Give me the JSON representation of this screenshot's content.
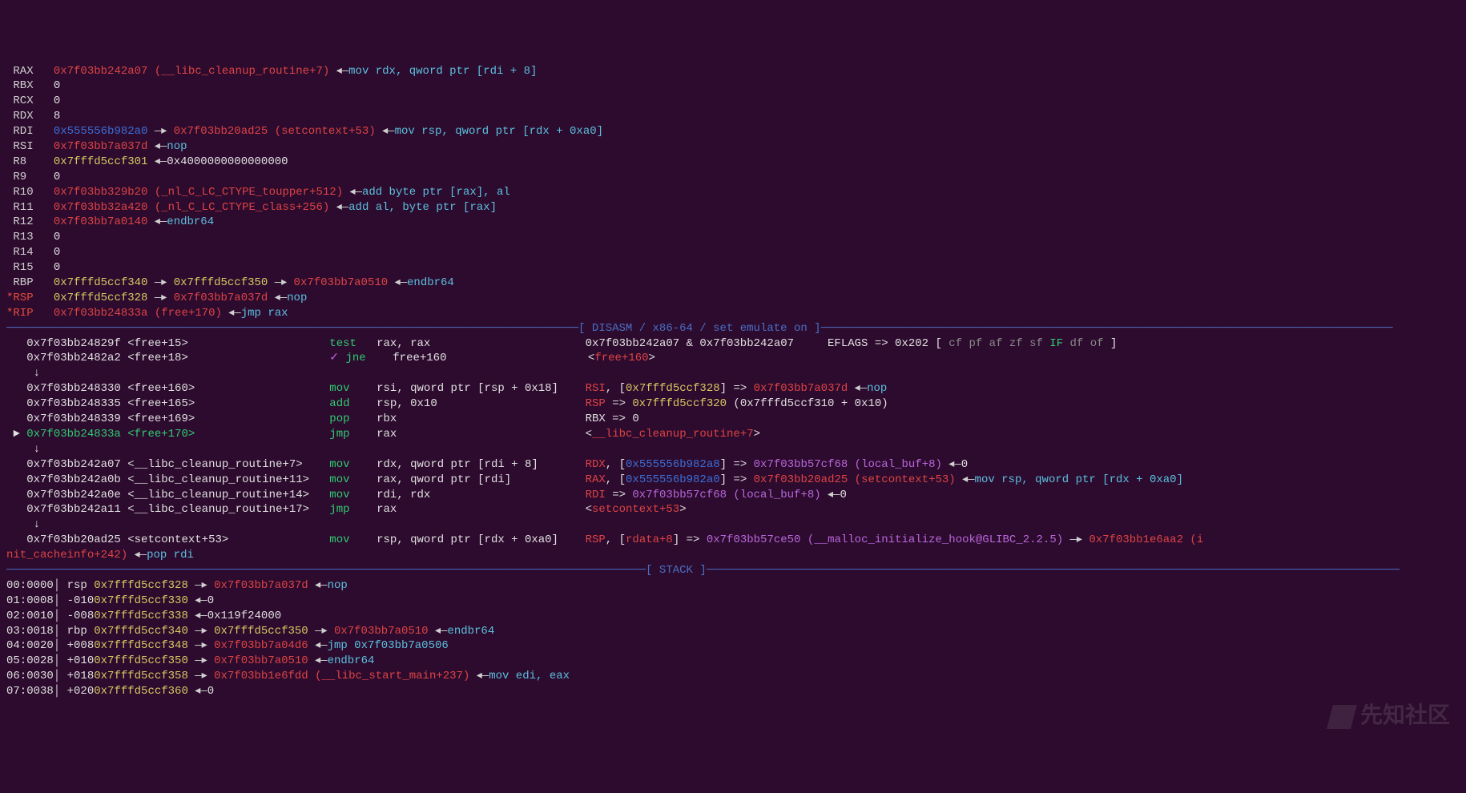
{
  "registers": [
    {
      "name": " RAX",
      "star": false,
      "parts": [
        {
          "cls": "addr-red",
          "t": "0x7f03bb242a07"
        },
        {
          "cls": "sym-red",
          "t": " (__libc_cleanup_routine+7)"
        },
        {
          "cls": "arrow",
          "t": " ◂—"
        },
        {
          "cls": "asm",
          "t": "mov rdx, qword ptr [rdi + 8]"
        }
      ]
    },
    {
      "name": " RBX",
      "star": false,
      "parts": [
        {
          "cls": "white",
          "t": "0"
        }
      ]
    },
    {
      "name": " RCX",
      "star": false,
      "parts": [
        {
          "cls": "white",
          "t": "0"
        }
      ]
    },
    {
      "name": " RDX",
      "star": false,
      "parts": [
        {
          "cls": "white",
          "t": "8"
        }
      ]
    },
    {
      "name": " RDI",
      "star": false,
      "parts": [
        {
          "cls": "addr-blue",
          "t": "0x555556b982a0"
        },
        {
          "cls": "arrow",
          "t": " —▸ "
        },
        {
          "cls": "addr-red",
          "t": "0x7f03bb20ad25"
        },
        {
          "cls": "sym-red",
          "t": " (setcontext+53)"
        },
        {
          "cls": "arrow",
          "t": " ◂—"
        },
        {
          "cls": "asm",
          "t": "mov rsp, qword ptr [rdx + 0xa0]"
        }
      ]
    },
    {
      "name": " RSI",
      "star": false,
      "parts": [
        {
          "cls": "addr-red",
          "t": "0x7f03bb7a037d"
        },
        {
          "cls": "arrow",
          "t": " ◂—"
        },
        {
          "cls": "asm",
          "t": "nop"
        }
      ]
    },
    {
      "name": " R8 ",
      "star": false,
      "parts": [
        {
          "cls": "offset",
          "t": "0x7fffd5ccf301"
        },
        {
          "cls": "arrow",
          "t": " ◂—"
        },
        {
          "cls": "white",
          "t": "0x4000000000000000"
        }
      ]
    },
    {
      "name": " R9 ",
      "star": false,
      "parts": [
        {
          "cls": "white",
          "t": "0"
        }
      ]
    },
    {
      "name": " R10",
      "star": false,
      "parts": [
        {
          "cls": "addr-red",
          "t": "0x7f03bb329b20"
        },
        {
          "cls": "sym-red",
          "t": " (_nl_C_LC_CTYPE_toupper+512)"
        },
        {
          "cls": "arrow",
          "t": " ◂—"
        },
        {
          "cls": "asm",
          "t": "add byte ptr [rax], al"
        }
      ]
    },
    {
      "name": " R11",
      "star": false,
      "parts": [
        {
          "cls": "addr-red",
          "t": "0x7f03bb32a420"
        },
        {
          "cls": "sym-red",
          "t": " (_nl_C_LC_CTYPE_class+256)"
        },
        {
          "cls": "arrow",
          "t": " ◂—"
        },
        {
          "cls": "asm",
          "t": "add al, byte ptr [rax]"
        }
      ]
    },
    {
      "name": " R12",
      "star": false,
      "parts": [
        {
          "cls": "addr-red",
          "t": "0x7f03bb7a0140"
        },
        {
          "cls": "arrow",
          "t": " ◂—"
        },
        {
          "cls": "asm",
          "t": "endbr64"
        }
      ]
    },
    {
      "name": " R13",
      "star": false,
      "parts": [
        {
          "cls": "white",
          "t": "0"
        }
      ]
    },
    {
      "name": " R14",
      "star": false,
      "parts": [
        {
          "cls": "white",
          "t": "0"
        }
      ]
    },
    {
      "name": " R15",
      "star": false,
      "parts": [
        {
          "cls": "white",
          "t": "0"
        }
      ]
    },
    {
      "name": " RBP",
      "star": false,
      "parts": [
        {
          "cls": "offset",
          "t": "0x7fffd5ccf340"
        },
        {
          "cls": "arrow",
          "t": " —▸ "
        },
        {
          "cls": "offset",
          "t": "0x7fffd5ccf350"
        },
        {
          "cls": "arrow",
          "t": " —▸ "
        },
        {
          "cls": "addr-red",
          "t": "0x7f03bb7a0510"
        },
        {
          "cls": "arrow",
          "t": " ◂—"
        },
        {
          "cls": "asm",
          "t": "endbr64"
        }
      ]
    },
    {
      "name": "*RSP",
      "star": true,
      "parts": [
        {
          "cls": "offset",
          "t": "0x7fffd5ccf328"
        },
        {
          "cls": "arrow",
          "t": " —▸ "
        },
        {
          "cls": "addr-red",
          "t": "0x7f03bb7a037d"
        },
        {
          "cls": "arrow",
          "t": " ◂—"
        },
        {
          "cls": "asm",
          "t": "nop"
        }
      ]
    },
    {
      "name": "*RIP",
      "star": true,
      "parts": [
        {
          "cls": "addr-red",
          "t": "0x7f03bb24833a"
        },
        {
          "cls": "sym-red",
          "t": " (free+170)"
        },
        {
          "cls": "arrow",
          "t": " ◂—"
        },
        {
          "cls": "asm",
          "t": "jmp rax"
        }
      ]
    }
  ],
  "disasm_header": "─────────────────────────────────────────────────────────────────────────────────────[ DISASM / x86-64 / set emulate on ]─────────────────────────────────────────────────────────────────────────────────────",
  "disasm": [
    {
      "pre": "   ",
      "addr": "0x7f03bb24829f",
      "acls": "white",
      "sym": "<free+15>",
      "scls": "white",
      "asm": "test   rax, rax",
      "ann": [
        {
          "cls": "white",
          "t": "0x7f03bb242a07 & 0x7f03bb242a07     EFLAGS => 0x202 [ "
        },
        {
          "cls": "flag-off",
          "t": "cf pf af zf sf "
        },
        {
          "cls": "flag-on",
          "t": "IF "
        },
        {
          "cls": "flag-off",
          "t": "df of "
        },
        {
          "cls": "white",
          "t": "]"
        }
      ]
    },
    {
      "pre": "   ",
      "addr": "0x7f03bb2482a2",
      "acls": "white",
      "sym": "<free+18>",
      "scls": "white",
      "asm": "✓ jne    free+160",
      "ann": [
        {
          "cls": "white",
          "t": "<"
        },
        {
          "cls": "sym-red",
          "t": "free+160"
        },
        {
          "cls": "white",
          "t": ">"
        }
      ]
    },
    {
      "pre": "    ↓",
      "addr": "",
      "acls": "",
      "sym": "",
      "scls": "",
      "asm": "",
      "ann": []
    },
    {
      "pre": "   ",
      "addr": "0x7f03bb248330",
      "acls": "white",
      "sym": "<free+160>",
      "scls": "white",
      "asm": "mov    rsi, qword ptr [rsp + 0x18]",
      "ann": [
        {
          "cls": "sym-red",
          "t": "RSI"
        },
        {
          "cls": "white",
          "t": ", ["
        },
        {
          "cls": "offset",
          "t": "0x7fffd5ccf328"
        },
        {
          "cls": "white",
          "t": "] => "
        },
        {
          "cls": "addr-red",
          "t": "0x7f03bb7a037d"
        },
        {
          "cls": "arrow",
          "t": " ◂—"
        },
        {
          "cls": "asm",
          "t": "nop"
        }
      ]
    },
    {
      "pre": "   ",
      "addr": "0x7f03bb248335",
      "acls": "white",
      "sym": "<free+165>",
      "scls": "white",
      "asm": "add    rsp, 0x10",
      "ann": [
        {
          "cls": "sym-red",
          "t": "RSP"
        },
        {
          "cls": "white",
          "t": " => "
        },
        {
          "cls": "offset",
          "t": "0x7fffd5ccf320"
        },
        {
          "cls": "white",
          "t": " (0x7fffd5ccf310 + 0x10)"
        }
      ]
    },
    {
      "pre": "   ",
      "addr": "0x7f03bb248339",
      "acls": "white",
      "sym": "<free+169>",
      "scls": "white",
      "asm": "pop    rbx",
      "ann": [
        {
          "cls": "white",
          "t": "RBX => 0"
        }
      ]
    },
    {
      "pre": " ► ",
      "addr": "0x7f03bb24833a",
      "acls": "addr-green",
      "sym": "<free+170>",
      "scls": "addr-green",
      "asm": "jmp    rax",
      "ann": [
        {
          "cls": "white",
          "t": "<"
        },
        {
          "cls": "sym-red",
          "t": "__libc_cleanup_routine+7"
        },
        {
          "cls": "white",
          "t": ">"
        }
      ]
    },
    {
      "pre": "    ↓",
      "addr": "",
      "acls": "",
      "sym": "",
      "scls": "",
      "asm": "",
      "ann": []
    },
    {
      "pre": "   ",
      "addr": "0x7f03bb242a07",
      "acls": "white",
      "sym": "<__libc_cleanup_routine+7>",
      "scls": "white",
      "asm": "mov    rdx, qword ptr [rdi + 8]",
      "ann": [
        {
          "cls": "sym-red",
          "t": "RDX"
        },
        {
          "cls": "white",
          "t": ", ["
        },
        {
          "cls": "addr-blue",
          "t": "0x555556b982a8"
        },
        {
          "cls": "white",
          "t": "] => "
        },
        {
          "cls": "addr-purple",
          "t": "0x7f03bb57cf68"
        },
        {
          "cls": "sym-purple",
          "t": " (local_buf+8)"
        },
        {
          "cls": "arrow",
          "t": " ◂—"
        },
        {
          "cls": "white",
          "t": "0"
        }
      ]
    },
    {
      "pre": "   ",
      "addr": "0x7f03bb242a0b",
      "acls": "white",
      "sym": "<__libc_cleanup_routine+11>",
      "scls": "white",
      "asm": "mov    rax, qword ptr [rdi]",
      "ann": [
        {
          "cls": "sym-red",
          "t": "RAX"
        },
        {
          "cls": "white",
          "t": ", ["
        },
        {
          "cls": "addr-blue",
          "t": "0x555556b982a0"
        },
        {
          "cls": "white",
          "t": "] => "
        },
        {
          "cls": "addr-red",
          "t": "0x7f03bb20ad25"
        },
        {
          "cls": "sym-red",
          "t": " (setcontext+53)"
        },
        {
          "cls": "arrow",
          "t": " ◂—"
        },
        {
          "cls": "asm",
          "t": "mov rsp, qword ptr [rdx + 0xa0]"
        }
      ]
    },
    {
      "pre": "   ",
      "addr": "0x7f03bb242a0e",
      "acls": "white",
      "sym": "<__libc_cleanup_routine+14>",
      "scls": "white",
      "asm": "mov    rdi, rdx",
      "ann": [
        {
          "cls": "sym-red",
          "t": "RDI"
        },
        {
          "cls": "white",
          "t": " => "
        },
        {
          "cls": "addr-purple",
          "t": "0x7f03bb57cf68"
        },
        {
          "cls": "sym-purple",
          "t": " (local_buf+8)"
        },
        {
          "cls": "arrow",
          "t": " ◂—"
        },
        {
          "cls": "white",
          "t": "0"
        }
      ]
    },
    {
      "pre": "   ",
      "addr": "0x7f03bb242a11",
      "acls": "white",
      "sym": "<__libc_cleanup_routine+17>",
      "scls": "white",
      "asm": "jmp    rax",
      "ann": [
        {
          "cls": "white",
          "t": "<"
        },
        {
          "cls": "sym-red",
          "t": "setcontext+53"
        },
        {
          "cls": "white",
          "t": ">"
        }
      ]
    },
    {
      "pre": "    ↓",
      "addr": "",
      "acls": "",
      "sym": "",
      "scls": "",
      "asm": "",
      "ann": []
    },
    {
      "pre": "   ",
      "addr": "0x7f03bb20ad25",
      "acls": "white",
      "sym": "<setcontext+53>",
      "scls": "white",
      "asm": "mov    rsp, qword ptr [rdx + 0xa0]",
      "ann": [
        {
          "cls": "sym-red",
          "t": "RSP"
        },
        {
          "cls": "white",
          "t": ", ["
        },
        {
          "cls": "sym-red",
          "t": "rdata+8"
        },
        {
          "cls": "white",
          "t": "] => "
        },
        {
          "cls": "addr-purple",
          "t": "0x7f03bb57ce50"
        },
        {
          "cls": "sym-purple",
          "t": " (__malloc_initialize_hook@GLIBC_2.2.5)"
        },
        {
          "cls": "arrow",
          "t": " —▸ "
        },
        {
          "cls": "addr-red",
          "t": "0x7f03bb1e6aa2"
        },
        {
          "cls": "sym-red",
          "t": " (i"
        }
      ]
    }
  ],
  "disasm_tail": [
    {
      "cls": "sym-red",
      "t": "nit_cacheinfo+242)"
    },
    {
      "cls": "arrow",
      "t": " ◂—"
    },
    {
      "cls": "asm",
      "t": "pop rdi"
    }
  ],
  "stack_header": "───────────────────────────────────────────────────────────────────────────────────────────────[ STACK ]───────────────────────────────────────────────────────────────────────────────────────────────────────",
  "stack": [
    {
      "off": "00:0000",
      "sep": "│",
      "nm": "rsp",
      "addr": "0x7fffd5ccf328",
      "parts": [
        {
          "cls": "arrow",
          "t": " —▸ "
        },
        {
          "cls": "addr-red",
          "t": "0x7f03bb7a037d"
        },
        {
          "cls": "arrow",
          "t": " ◂—"
        },
        {
          "cls": "asm",
          "t": "nop"
        }
      ]
    },
    {
      "off": "01:0008",
      "sep": "│",
      "nm": "-010",
      "addr": "0x7fffd5ccf330",
      "parts": [
        {
          "cls": "arrow",
          "t": " ◂—"
        },
        {
          "cls": "white",
          "t": "0"
        }
      ]
    },
    {
      "off": "02:0010",
      "sep": "│",
      "nm": "-008",
      "addr": "0x7fffd5ccf338",
      "parts": [
        {
          "cls": "arrow",
          "t": " ◂—"
        },
        {
          "cls": "white",
          "t": "0x119f24000"
        }
      ]
    },
    {
      "off": "03:0018",
      "sep": "│",
      "nm": "rbp",
      "addr": "0x7fffd5ccf340",
      "parts": [
        {
          "cls": "arrow",
          "t": " —▸ "
        },
        {
          "cls": "offset",
          "t": "0x7fffd5ccf350"
        },
        {
          "cls": "arrow",
          "t": " —▸ "
        },
        {
          "cls": "addr-red",
          "t": "0x7f03bb7a0510"
        },
        {
          "cls": "arrow",
          "t": " ◂—"
        },
        {
          "cls": "asm",
          "t": "endbr64"
        }
      ]
    },
    {
      "off": "04:0020",
      "sep": "│",
      "nm": "+008",
      "addr": "0x7fffd5ccf348",
      "parts": [
        {
          "cls": "arrow",
          "t": " —▸ "
        },
        {
          "cls": "addr-red",
          "t": "0x7f03bb7a04d6"
        },
        {
          "cls": "arrow",
          "t": " ◂—"
        },
        {
          "cls": "asm",
          "t": "jmp 0x7f03bb7a0506"
        }
      ]
    },
    {
      "off": "05:0028",
      "sep": "│",
      "nm": "+010",
      "addr": "0x7fffd5ccf350",
      "parts": [
        {
          "cls": "arrow",
          "t": " —▸ "
        },
        {
          "cls": "addr-red",
          "t": "0x7f03bb7a0510"
        },
        {
          "cls": "arrow",
          "t": " ◂—"
        },
        {
          "cls": "asm",
          "t": "endbr64"
        }
      ]
    },
    {
      "off": "06:0030",
      "sep": "│",
      "nm": "+018",
      "addr": "0x7fffd5ccf358",
      "parts": [
        {
          "cls": "arrow",
          "t": " —▸ "
        },
        {
          "cls": "addr-red",
          "t": "0x7f03bb1e6fdd"
        },
        {
          "cls": "sym-red",
          "t": " (__libc_start_main+237)"
        },
        {
          "cls": "arrow",
          "t": " ◂—"
        },
        {
          "cls": "asm",
          "t": "mov edi, eax"
        }
      ]
    },
    {
      "off": "07:0038",
      "sep": "│",
      "nm": "+020",
      "addr": "0x7fffd5ccf360",
      "parts": [
        {
          "cls": "arrow",
          "t": " ◂—"
        },
        {
          "cls": "white",
          "t": "0"
        }
      ]
    }
  ],
  "watermark": "先知社区"
}
